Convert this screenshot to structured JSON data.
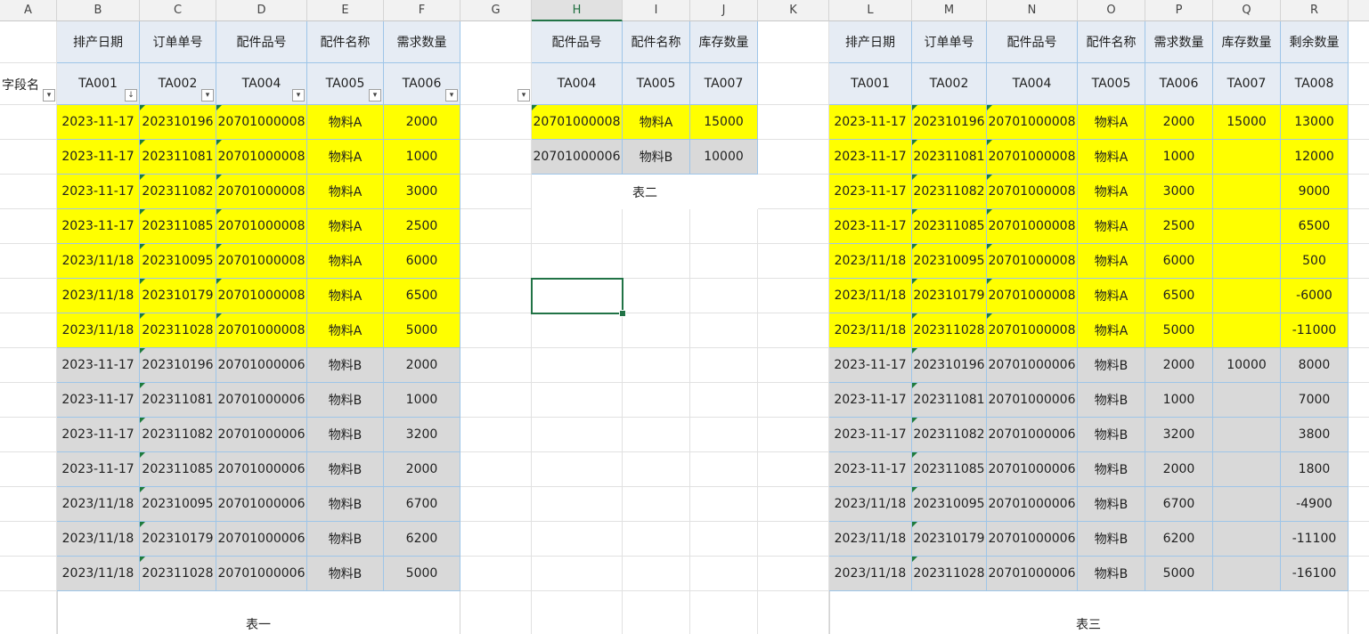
{
  "columns": [
    "A",
    "B",
    "C",
    "D",
    "E",
    "F",
    "G",
    "H",
    "I",
    "J",
    "K",
    "L",
    "M",
    "N",
    "O",
    "P",
    "Q",
    "R"
  ],
  "active_column": "H",
  "left_label": "字段名",
  "table1": {
    "caption": "表一",
    "headers": [
      "排产日期",
      "订单单号",
      "配件品号",
      "配件名称",
      "需求数量"
    ],
    "codes": [
      "TA001",
      "TA002",
      "TA004",
      "TA005",
      "TA006"
    ],
    "rows": [
      [
        "2023-11-17",
        "202310196",
        "20701000008",
        "物料A",
        "2000"
      ],
      [
        "2023-11-17",
        "202311081",
        "20701000008",
        "物料A",
        "1000"
      ],
      [
        "2023-11-17",
        "202311082",
        "20701000008",
        "物料A",
        "3000"
      ],
      [
        "2023-11-17",
        "202311085",
        "20701000008",
        "物料A",
        "2500"
      ],
      [
        "2023/11/18",
        "202310095",
        "20701000008",
        "物料A",
        "6000"
      ],
      [
        "2023/11/18",
        "202310179",
        "20701000008",
        "物料A",
        "6500"
      ],
      [
        "2023/11/18",
        "202311028",
        "20701000008",
        "物料A",
        "5000"
      ],
      [
        "2023-11-17",
        "202310196",
        "20701000006",
        "物料B",
        "2000"
      ],
      [
        "2023-11-17",
        "202311081",
        "20701000006",
        "物料B",
        "1000"
      ],
      [
        "2023-11-17",
        "202311082",
        "20701000006",
        "物料B",
        "3200"
      ],
      [
        "2023-11-17",
        "202311085",
        "20701000006",
        "物料B",
        "2000"
      ],
      [
        "2023/11/18",
        "202310095",
        "20701000006",
        "物料B",
        "6700"
      ],
      [
        "2023/11/18",
        "202310179",
        "20701000006",
        "物料B",
        "6200"
      ],
      [
        "2023/11/18",
        "202311028",
        "20701000006",
        "物料B",
        "5000"
      ]
    ]
  },
  "table2": {
    "caption": "表二",
    "headers": [
      "配件品号",
      "配件名称",
      "库存数量"
    ],
    "codes": [
      "TA004",
      "TA005",
      "TA007"
    ],
    "rows": [
      [
        "20701000008",
        "物料A",
        "15000"
      ],
      [
        "20701000006",
        "物料B",
        "10000"
      ]
    ]
  },
  "table3": {
    "caption": "表三",
    "headers": [
      "排产日期",
      "订单单号",
      "配件品号",
      "配件名称",
      "需求数量",
      "库存数量",
      "剩余数量"
    ],
    "codes": [
      "TA001",
      "TA002",
      "TA004",
      "TA005",
      "TA006",
      "TA007",
      "TA008"
    ],
    "rows": [
      [
        "2023-11-17",
        "202310196",
        "20701000008",
        "物料A",
        "2000",
        "15000",
        "13000"
      ],
      [
        "2023-11-17",
        "202311081",
        "20701000008",
        "物料A",
        "1000",
        "",
        "12000"
      ],
      [
        "2023-11-17",
        "202311082",
        "20701000008",
        "物料A",
        "3000",
        "",
        "9000"
      ],
      [
        "2023-11-17",
        "202311085",
        "20701000008",
        "物料A",
        "2500",
        "",
        "6500"
      ],
      [
        "2023/11/18",
        "202310095",
        "20701000008",
        "物料A",
        "6000",
        "",
        "500"
      ],
      [
        "2023/11/18",
        "202310179",
        "20701000008",
        "物料A",
        "6500",
        "",
        "-6000"
      ],
      [
        "2023/11/18",
        "202311028",
        "20701000008",
        "物料A",
        "5000",
        "",
        "-11000"
      ],
      [
        "2023-11-17",
        "202310196",
        "20701000006",
        "物料B",
        "2000",
        "10000",
        "8000"
      ],
      [
        "2023-11-17",
        "202311081",
        "20701000006",
        "物料B",
        "1000",
        "",
        "7000"
      ],
      [
        "2023-11-17",
        "202311082",
        "20701000006",
        "物料B",
        "3200",
        "",
        "3800"
      ],
      [
        "2023-11-17",
        "202311085",
        "20701000006",
        "物料B",
        "2000",
        "",
        "1800"
      ],
      [
        "2023/11/18",
        "202310095",
        "20701000006",
        "物料B",
        "6700",
        "",
        "-4900"
      ],
      [
        "2023/11/18",
        "202310179",
        "20701000006",
        "物料B",
        "6200",
        "",
        "-11100"
      ],
      [
        "2023/11/18",
        "202311028",
        "20701000006",
        "物料B",
        "5000",
        "",
        "-16100"
      ]
    ]
  },
  "colors": {
    "material_a_fill": "#ffff00",
    "material_b_fill": "#d9d9d9",
    "header_fill": "#e6ecf4",
    "selection_border": "#217346"
  },
  "icons": {
    "filter": "filter-dropdown-icon",
    "sort_filter": "sort-filter-icon",
    "text_number": "number-stored-as-text-indicator-icon"
  }
}
